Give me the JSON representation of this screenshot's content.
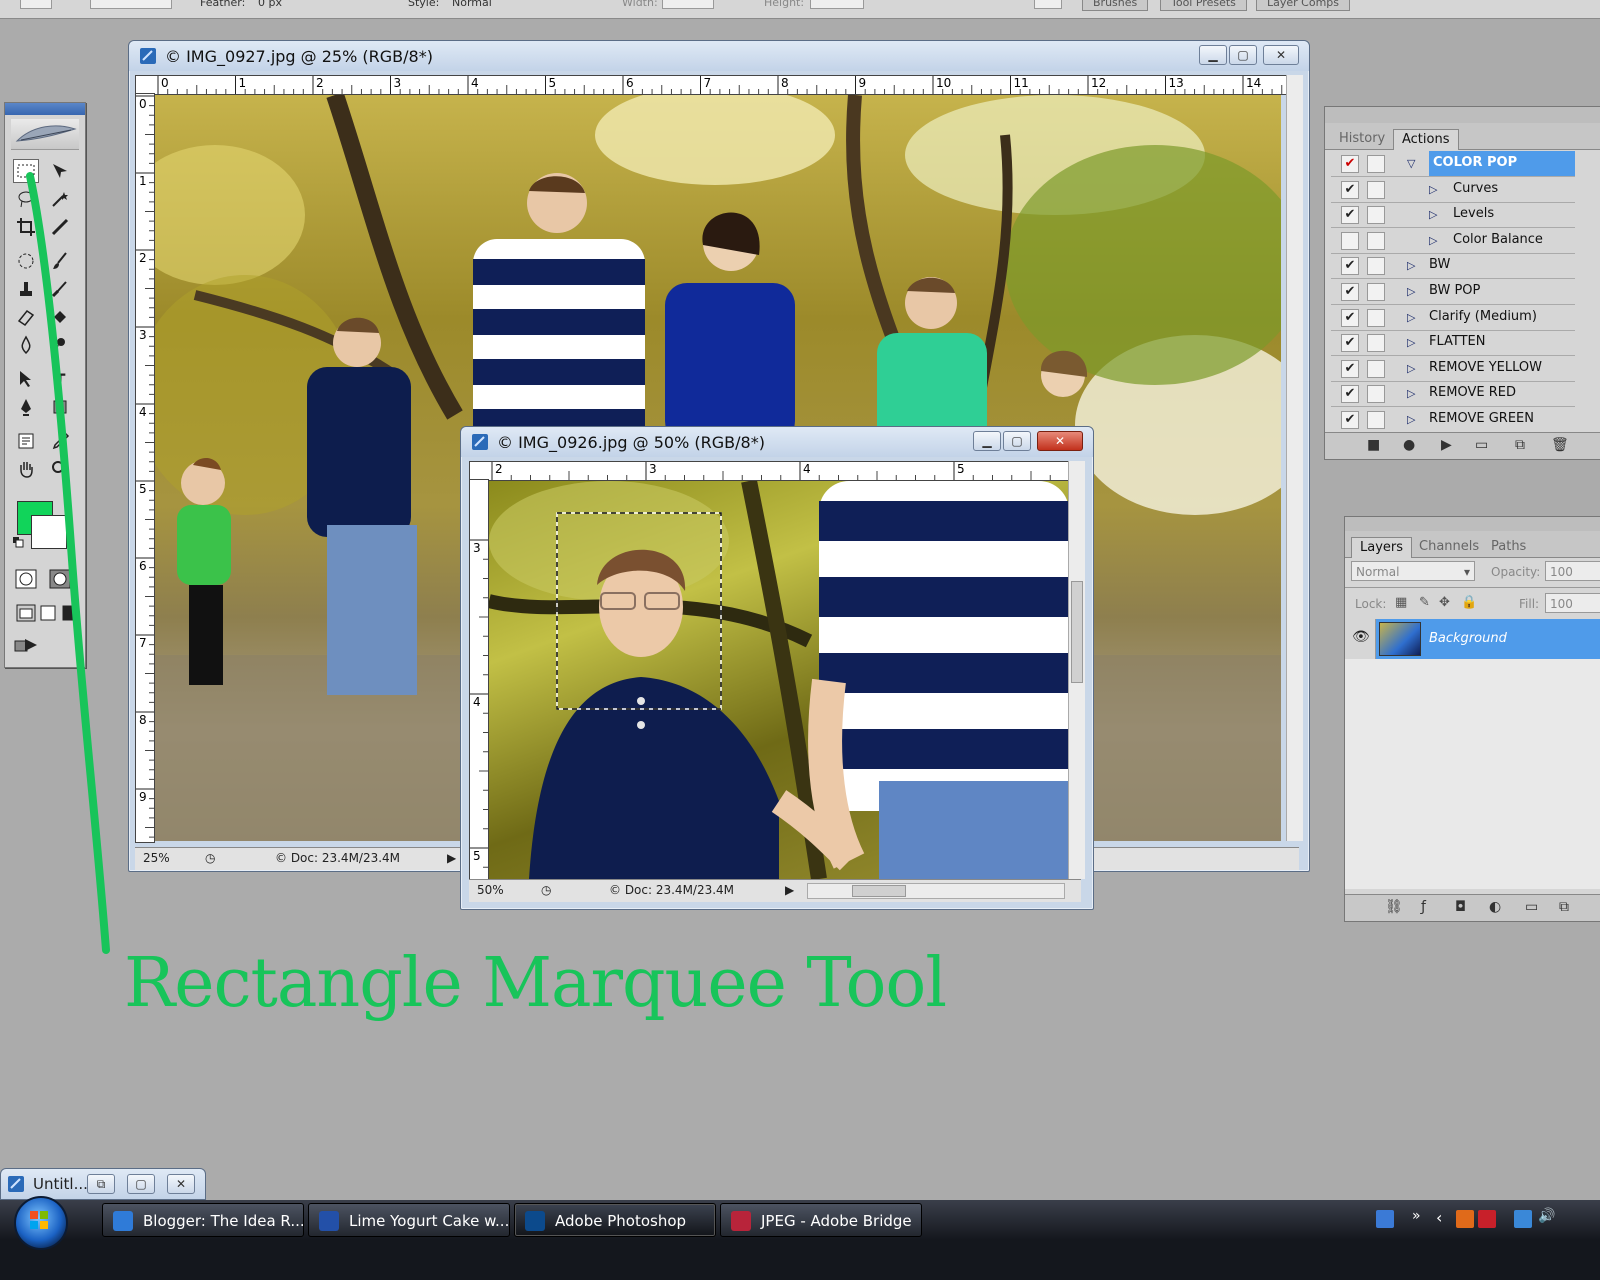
{
  "options_bar": {
    "feather_label": "Feather:",
    "feather_value": "0 px",
    "style_label": "Style:",
    "style_value": "Normal",
    "width_label": "Width:",
    "height_label": "Height:",
    "palette_tabs": [
      "Brushes",
      "Tool Presets",
      "Layer Comps"
    ]
  },
  "tools": {
    "selected": "rectangle-marquee",
    "foreground_color": "#11d45a",
    "background_color": "#ffffff"
  },
  "window_main": {
    "title": "© IMG_0927.jpg @ 25% (RGB/8*)",
    "ruler_h": [
      "0",
      "1",
      "2",
      "3",
      "4",
      "5",
      "6",
      "7",
      "8",
      "9",
      "10",
      "11",
      "12",
      "13",
      "14"
    ],
    "ruler_v": [
      "0",
      "1",
      "2",
      "3",
      "4",
      "5",
      "6",
      "7",
      "8",
      "9"
    ],
    "zoom": "25%",
    "doc_size": "© Doc: 23.4M/23.4M"
  },
  "window_second": {
    "title": "© IMG_0926.jpg @ 50% (RGB/8*)",
    "ruler_h": [
      "2",
      "3",
      "4",
      "5"
    ],
    "ruler_v": [
      "3",
      "4",
      "5"
    ],
    "zoom": "50%",
    "doc_size": "© Doc: 23.4M/23.4M"
  },
  "actions_panel": {
    "tabs": [
      "History",
      "Actions"
    ],
    "active_tab": "Actions",
    "items": [
      {
        "name": "COLOR POP",
        "checked": true,
        "expanded": true,
        "highlighted": true,
        "indent": 0,
        "check_color": "#cc0000"
      },
      {
        "name": "Curves",
        "checked": true,
        "indent": 1
      },
      {
        "name": "Levels",
        "checked": true,
        "indent": 1
      },
      {
        "name": "Color Balance",
        "checked": false,
        "indent": 1
      },
      {
        "name": "BW",
        "checked": true,
        "indent": 0
      },
      {
        "name": "BW POP",
        "checked": true,
        "indent": 0
      },
      {
        "name": "Clarify (Medium)",
        "checked": true,
        "indent": 0
      },
      {
        "name": "FLATTEN",
        "checked": true,
        "indent": 0
      },
      {
        "name": "REMOVE YELLOW",
        "checked": true,
        "indent": 0
      },
      {
        "name": "REMOVE RED",
        "checked": true,
        "indent": 0
      },
      {
        "name": "REMOVE GREEN",
        "checked": true,
        "indent": 0
      }
    ]
  },
  "layers_panel": {
    "tabs": [
      "Layers",
      "Channels",
      "Paths"
    ],
    "active_tab": "Layers",
    "blend_mode": "Normal",
    "opacity_label": "Opacity:",
    "opacity_value": "100",
    "lock_label": "Lock:",
    "fill_label": "Fill:",
    "fill_value": "100",
    "layer_name": "Background"
  },
  "annotation": {
    "text": "Rectangle Marquee Tool",
    "color": "#18c45a"
  },
  "minimized_window": {
    "title": "Untitl..."
  },
  "taskbar": {
    "items": [
      {
        "label": "Blogger: The Idea R...",
        "icon": "ie-icon"
      },
      {
        "label": "Lime Yogurt Cake w...",
        "icon": "word-icon"
      },
      {
        "label": "Adobe Photoshop",
        "icon": "photoshop-icon",
        "active": true
      },
      {
        "label": "JPEG - Adobe Bridge",
        "icon": "bridge-icon"
      }
    ]
  }
}
